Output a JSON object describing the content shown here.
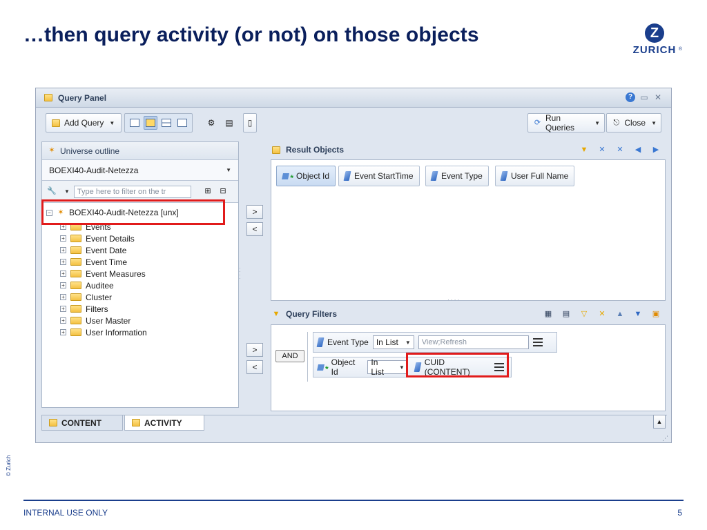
{
  "slide": {
    "title": "…then query activity (or not) on those objects",
    "logo_letter": "Z",
    "logo_text": "ZURICH",
    "logo_reg": "®",
    "side_copyright": "© Zurich",
    "footer_left": "INTERNAL USE ONLY",
    "page_number": "5"
  },
  "query_panel": {
    "title": "Query Panel",
    "toolbar": {
      "add_query": "Add Query",
      "run_queries": "Run Queries",
      "close": "Close"
    },
    "universe_outline": {
      "title": "Universe outline",
      "selected_universe": "BOEXI40-Audit-Netezza",
      "filter_placeholder": "Type here to filter on the tr",
      "root": "BOEXI40-Audit-Netezza [unx]",
      "folders": [
        "Events",
        "Event Details",
        "Event Date",
        "Event Time",
        "Event Measures",
        "Auditee",
        "Cluster",
        "Filters",
        "User Master",
        "User Information"
      ]
    },
    "move_buttons": {
      "add": ">",
      "remove": "<"
    },
    "result_objects": {
      "title": "Result Objects",
      "objects": [
        "Object Id",
        "Event StartTime",
        "Event Type",
        "User Full Name"
      ]
    },
    "query_filters": {
      "title": "Query Filters",
      "operator": "AND",
      "filters": [
        {
          "object": "Event Type",
          "op": "In List",
          "value": "View;Refresh"
        },
        {
          "object": "Object Id",
          "op": "In List",
          "value": "CUID (CONTENT)"
        }
      ]
    },
    "tabs": [
      "CONTENT",
      "ACTIVITY"
    ]
  },
  "colors": {
    "title": "#0a1f5c",
    "brand": "#1a3e8c",
    "highlight": "#e11b1b"
  }
}
